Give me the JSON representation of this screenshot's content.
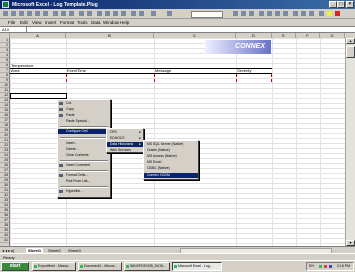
{
  "window": {
    "title": "Microsoft Excel - Log Template.Plug",
    "minimize": "_",
    "restore": "□",
    "close": "×"
  },
  "menubar": {
    "items": [
      "File",
      "Edit",
      "View",
      "Insert",
      "Format",
      "Tools",
      "Data",
      "Window",
      "Help"
    ]
  },
  "formula_bar": {
    "name_box": "A10"
  },
  "columns": [
    "A",
    "B",
    "C",
    "D",
    "E",
    "F",
    "G"
  ],
  "rows": [
    "1",
    "2",
    "3",
    "4",
    "5",
    "6",
    "7",
    "8",
    "9",
    "10",
    "11",
    "12",
    "13",
    "14",
    "15",
    "16",
    "17",
    "18",
    "19",
    "20",
    "21",
    "22",
    "23",
    "24",
    "25",
    "26",
    "27",
    "28",
    "29",
    "30",
    "31",
    "32",
    "33",
    "34",
    "35",
    "36",
    "37",
    "38",
    "39",
    "40",
    "41"
  ],
  "banner": {
    "text": "CONNEX"
  },
  "sheet": {
    "cells": {
      "a6": "Temperature",
      "a7": "Area",
      "b7": "EventTime",
      "c7": "Message",
      "d7": "Severity"
    }
  },
  "context_menu": {
    "items": [
      {
        "label": "Cut"
      },
      {
        "label": "Copy"
      },
      {
        "label": "Paste"
      },
      {
        "label": "Paste Special..."
      },
      {
        "label": "Configure Cell"
      },
      {
        "label": "Insert..."
      },
      {
        "label": "Delete..."
      },
      {
        "label": "Clear Contents"
      },
      {
        "label": "Insert Comment"
      },
      {
        "label": "Format Cells..."
      },
      {
        "label": "Pick From List..."
      },
      {
        "label": "Hyperlink..."
      }
    ]
  },
  "submenu1": {
    "items": [
      "OPC",
      "EDHOCS",
      "Data Historians",
      "Web Services"
    ]
  },
  "submenu2": {
    "items": [
      "MS SQL Server (Native)",
      "Oracle (Native)",
      "MS Access (Native)",
      "MS Excel",
      "ODBC (Native)",
      "Connex XGDM"
    ]
  },
  "sheet_tabs": {
    "nav": "◂ ◂ ▸ ▸|",
    "tabs": [
      "Sheet1",
      "Sheet2",
      "Sheet3"
    ]
  },
  "status": {
    "text": "Ready"
  },
  "taskbar": {
    "start": "start",
    "tasks": [
      "ExportHeet - Messa...",
      "Document1 - Micros...",
      "WINXPDEVDB_DATA...",
      "Microsoft Excel - Log..."
    ],
    "tray_left": "EN",
    "clock": "2:16 PM"
  },
  "colors": {
    "titlebar": "#0a246a",
    "menu_highlight": "#0a246a",
    "banner": "#6a72c8",
    "start_green": "#3b8a3b"
  }
}
